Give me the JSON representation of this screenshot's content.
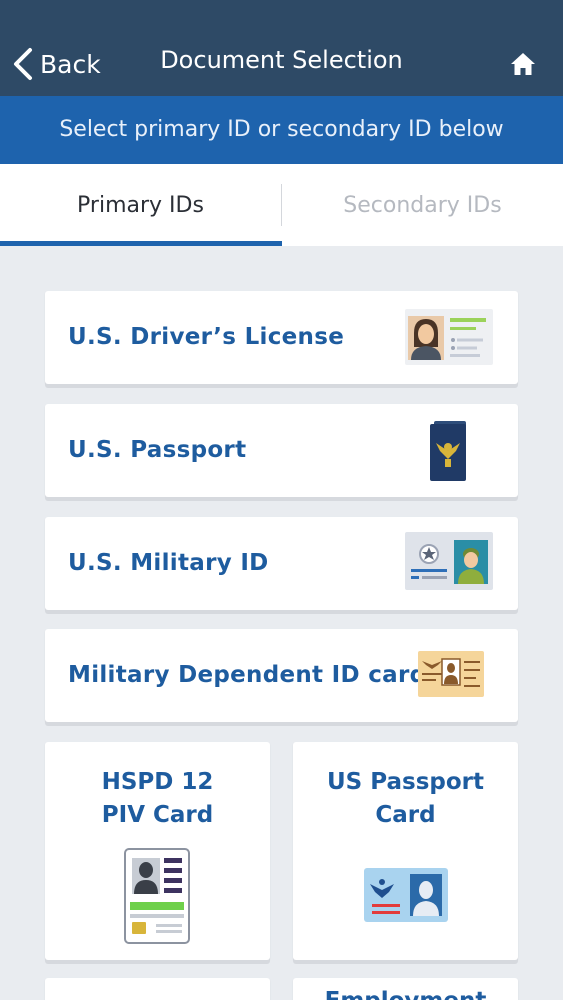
{
  "header": {
    "back_label": "Back",
    "title": "Document Selection"
  },
  "banner": {
    "text": "Select primary ID or secondary ID below"
  },
  "tabs": [
    {
      "label": "Primary IDs",
      "active": true
    },
    {
      "label": "Secondary IDs",
      "active": false
    }
  ],
  "documents": [
    {
      "label": "U.S. Driver’s License",
      "icon": "drivers-license-icon"
    },
    {
      "label": "U.S. Passport",
      "icon": "passport-icon"
    },
    {
      "label": "U.S. Military ID",
      "icon": "military-id-icon"
    },
    {
      "label": "Military Dependent ID card",
      "icon": "dependent-id-icon"
    },
    {
      "label": "HSPD 12\nPIV Card",
      "icon": "piv-card-icon"
    },
    {
      "label": "US Passport\nCard",
      "icon": "passport-card-icon"
    },
    {
      "label": "",
      "icon": ""
    },
    {
      "label": "Employment",
      "icon": ""
    }
  ],
  "colors": {
    "header_bg": "#2e4a66",
    "banner_bg": "#1e63ad",
    "accent": "#1e5c9f",
    "page_bg": "#e9ecf0"
  }
}
